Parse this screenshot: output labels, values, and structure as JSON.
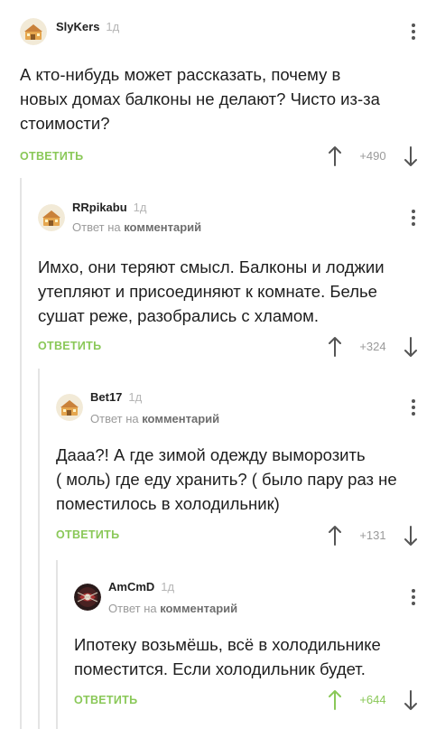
{
  "comments": [
    {
      "username": "SlyKers",
      "time": "1д",
      "reply_prefix": "",
      "reply_target": "",
      "text": "А кто-нибудь может рассказать, почему в\nновых домах балконы не делают? Чисто из-за\nстоимости?",
      "reply_label": "ответить",
      "rating": "+490",
      "voted": false,
      "avatar": "pikabu-default-avatar"
    },
    {
      "username": "RRpikabu",
      "time": "1д",
      "reply_prefix": "Ответ на ",
      "reply_target": "комментарий",
      "text": "Имхо, они теряют смысл. Балконы и лоджии\nутепляют и присоединяют к комнате. Белье\nсушат реже, разобрались с хламом.",
      "reply_label": "ответить",
      "rating": "+324",
      "voted": false,
      "avatar": "pikabu-default-avatar"
    },
    {
      "username": "Bet17",
      "time": "1д",
      "reply_prefix": "Ответ на ",
      "reply_target": "комментарий",
      "text": "Дааа?! А где зимой одежду выморозить\n( моль) где еду хранить? ( было пару раз не\nпоместилось в холодильник)",
      "reply_label": "ответить",
      "rating": "+131",
      "voted": false,
      "avatar": "pikabu-default-avatar"
    },
    {
      "username": "AmCmD",
      "time": "1д",
      "reply_prefix": "Ответ на ",
      "reply_target": "комментарий",
      "text": "Ипотеку возьмёшь, всё в холодильнике\nпоместится. Если холодильник будет.",
      "reply_label": "ответить",
      "rating": "+644",
      "voted": true,
      "avatar": "dark-custom-avatar"
    }
  ],
  "colors": {
    "accent": "#8ac858",
    "muted": "#9a9a9a",
    "thread_line": "#e4e4e4"
  }
}
